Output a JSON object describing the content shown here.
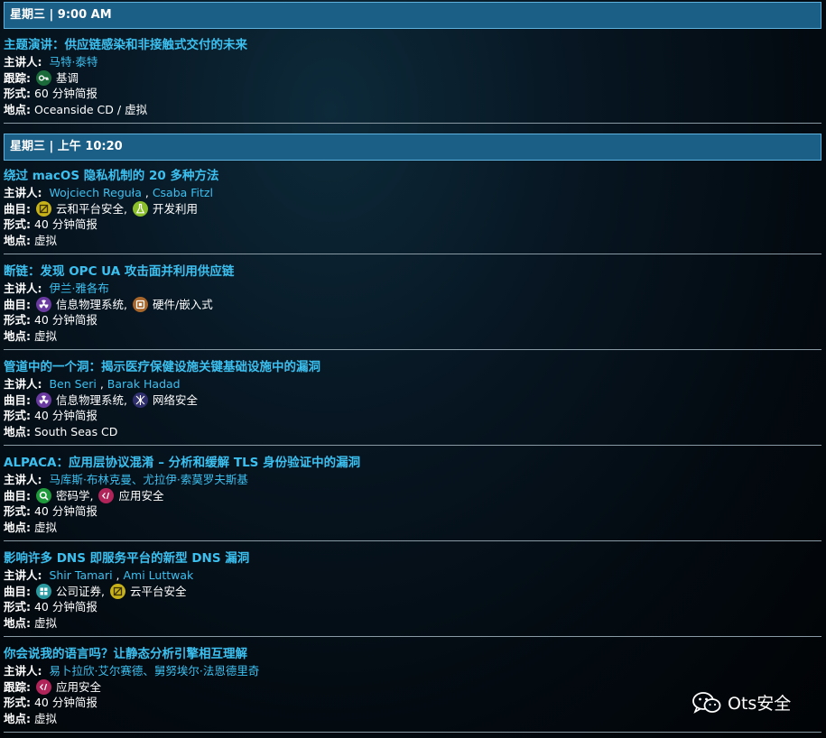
{
  "headers": [
    {
      "text": "星期三 | 9:00 AM"
    },
    {
      "text": "星期三 | 上午 10:20"
    }
  ],
  "labels": {
    "speaker": "主讲人:",
    "track": "跟踪:",
    "tracks": "曲目:",
    "format": "形式:",
    "location": "地点:"
  },
  "sessions": [
    {
      "title": "主题演讲：供应链感染和非接触式交付的未来",
      "track_label": "跟踪:",
      "speakers": [
        "马特·泰特"
      ],
      "tracks": [
        {
          "name": "基调",
          "icon": "key-icon",
          "color": "#1b6b3a"
        }
      ],
      "format": "60 分钟简报",
      "location": "Oceanside CD / 虚拟"
    },
    {
      "title": "绕过 macOS 隐私机制的 20 多种方法",
      "track_label": "曲目:",
      "speakers": [
        "Wojciech Reguła",
        "Csaba Fitzl"
      ],
      "tracks": [
        {
          "name": "云和平台安全,",
          "icon": "cloud-platform-icon",
          "color": "#c8b21a"
        },
        {
          "name": "开发利用",
          "icon": "flask-icon",
          "color": "#8bbf2a"
        }
      ],
      "format": "40 分钟简报",
      "location": "虚拟"
    },
    {
      "title": "断链：发现 OPC UA 攻击面并利用供应链",
      "track_label": "曲目:",
      "speakers": [
        "伊兰·雅各布"
      ],
      "tracks": [
        {
          "name": "信息物理系统,",
          "icon": "radiation-icon",
          "color": "#6a3aa0"
        },
        {
          "name": "硬件/嵌入式",
          "icon": "chip-icon",
          "color": "#a8662a"
        }
      ],
      "format": "40 分钟简报",
      "location": "虚拟"
    },
    {
      "title": "管道中的一个洞：揭示医疗保健设施关键基础设施中的漏洞",
      "track_label": "曲目:",
      "speakers": [
        "Ben Seri",
        "Barak Hadad"
      ],
      "tracks": [
        {
          "name": "信息物理系统,",
          "icon": "radiation-icon",
          "color": "#6a3aa0"
        },
        {
          "name": "网络安全",
          "icon": "network-icon",
          "color": "#2f2f6e"
        }
      ],
      "format": "40 分钟简报",
      "location": "South Seas CD"
    },
    {
      "title": "ALPACA：应用层协议混淆 – 分析和缓解 TLS 身份验证中的漏洞",
      "track_label": "曲目:",
      "speakers": [
        "马库斯·布林克曼、尤拉伊·索莫罗夫斯基"
      ],
      "tracks": [
        {
          "name": "密码学,",
          "icon": "magnifier-icon",
          "color": "#1e9a3c"
        },
        {
          "name": "应用安全",
          "icon": "code-icon",
          "color": "#b0245a"
        }
      ],
      "format": "40 分钟简报",
      "location": "虚拟"
    },
    {
      "title": "影响许多 DNS 即服务平台的新型 DNS 漏洞",
      "track_label": "曲目:",
      "speakers": [
        "Shir Tamari",
        "Ami Luttwak"
      ],
      "tracks": [
        {
          "name": "公司证券,",
          "icon": "enterprise-icon",
          "color": "#2a9aa0"
        },
        {
          "name": "云平台安全",
          "icon": "cloud-platform-icon",
          "color": "#c8b21a"
        }
      ],
      "format": "40 分钟简报",
      "location": "虚拟"
    },
    {
      "title": "你会说我的语言吗？让静态分析引擎相互理解",
      "track_label": "跟踪:",
      "speakers": [
        "易卜拉欣·艾尔赛德、舅努埃尔·法恩德里奇"
      ],
      "tracks": [
        {
          "name": "应用安全",
          "icon": "code-icon",
          "color": "#b0245a"
        }
      ],
      "format": "40 分钟简报",
      "location": "虚拟"
    }
  ],
  "watermark": {
    "text": "Ots安全",
    "icon": "wechat-icon"
  }
}
